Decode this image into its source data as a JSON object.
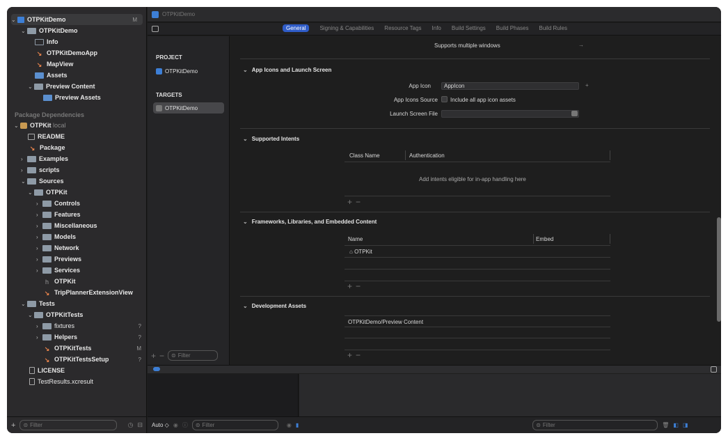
{
  "navigator": {
    "items": [
      {
        "label": "OTPKitDemo",
        "badge": "M"
      },
      {
        "label": "OTPKitDemo",
        "badge": ""
      },
      {
        "label": "Info",
        "badge": ""
      },
      {
        "label": "OTPKitDemoApp",
        "badge": ""
      },
      {
        "label": "MapView",
        "badge": ""
      },
      {
        "label": "Assets",
        "badge": ""
      },
      {
        "label": "Preview Content",
        "badge": ""
      },
      {
        "label": "Preview Assets",
        "badge": ""
      },
      {
        "label": "Package Dependencies",
        "badge": ""
      },
      {
        "label": "OTPKit",
        "badge": "local"
      },
      {
        "label": "README",
        "badge": ""
      },
      {
        "label": "Package",
        "badge": ""
      },
      {
        "label": "Examples",
        "badge": ""
      },
      {
        "label": "scripts",
        "badge": ""
      },
      {
        "label": "Sources",
        "badge": ""
      },
      {
        "label": "OTPKit",
        "badge": ""
      },
      {
        "label": "Controls",
        "badge": ""
      },
      {
        "label": "Features",
        "badge": ""
      },
      {
        "label": "Miscellaneous",
        "badge": ""
      },
      {
        "label": "Models",
        "badge": ""
      },
      {
        "label": "Network",
        "badge": ""
      },
      {
        "label": "Previews",
        "badge": ""
      },
      {
        "label": "Services",
        "badge": ""
      },
      {
        "label": "OTPKit",
        "badge": ""
      },
      {
        "label": "TripPlannerExtensionView",
        "badge": ""
      },
      {
        "label": "Tests",
        "badge": ""
      },
      {
        "label": "OTPKitTests",
        "badge": ""
      },
      {
        "label": "fixtures",
        "badge": "?"
      },
      {
        "label": "Helpers",
        "badge": "?"
      },
      {
        "label": "OTPKitTests",
        "badge": "M"
      },
      {
        "label": "OTPKitTestsSetup",
        "badge": "?"
      },
      {
        "label": "LICENSE",
        "badge": ""
      },
      {
        "label": "TestResults.xcresult",
        "badge": ""
      }
    ],
    "filter_placeholder": "Filter"
  },
  "window": {
    "tab_title": "OTPKitDemo"
  },
  "tabs": [
    "General",
    "Signing & Capabilities",
    "Resource Tags",
    "Info",
    "Build Settings",
    "Build Phases",
    "Build Rules"
  ],
  "targets_panel": {
    "project_header": "PROJECT",
    "project_item": "OTPKitDemo",
    "targets_header": "TARGETS",
    "target_item": "OTPKitDemo",
    "filter_placeholder": "Filter"
  },
  "editor": {
    "supports_multiple_windows": "Supports multiple windows",
    "app_icons": {
      "title": "App Icons and Launch Screen",
      "app_icon_label": "App Icon",
      "app_icon_value": "AppIcon",
      "sources_label": "App Icons Source",
      "sources_value": "Include all app icon assets",
      "launch_label": "Launch Screen File"
    },
    "intents": {
      "title": "Supported Intents",
      "col1": "Class Name",
      "col2": "Authentication",
      "empty": "Add intents eligible for in-app handling here"
    },
    "frameworks": {
      "title": "Frameworks, Libraries, and Embedded Content",
      "col1": "Name",
      "col2": "Embed",
      "row1": "OTPKit"
    },
    "dev_assets": {
      "title": "Development Assets",
      "row1": "OTPKitDemo/Preview Content"
    }
  },
  "bottom": {
    "auto_label": "Auto ◇",
    "filter_left": "Filter",
    "filter_right": "Filter"
  }
}
